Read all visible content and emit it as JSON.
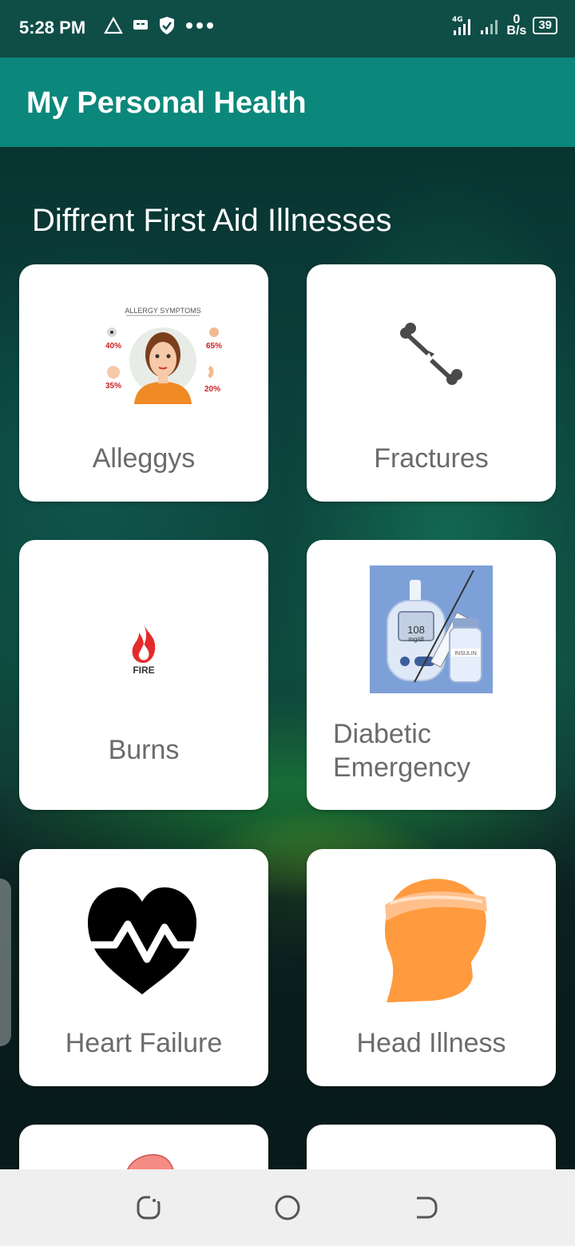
{
  "status_bar": {
    "time": "5:28 PM",
    "left_icons": [
      "alert-triangle-icon",
      "message-icon",
      "shield-check-icon",
      "more-dots-icon"
    ],
    "network": "4G",
    "data_rate_value": "0",
    "data_rate_unit": "B/s",
    "battery": "39"
  },
  "app_bar": {
    "title": "My Personal Health"
  },
  "section_title": "Diffrent First Aid Illnesses",
  "cards": [
    {
      "id": "allergies",
      "label": "Alleggys",
      "image": "allergy-symptoms-icon",
      "image_text": "ALLERGY SYMPTOMS",
      "stats": [
        "40%",
        "65%",
        "35%",
        "20%"
      ]
    },
    {
      "id": "fractures",
      "label": "Fractures",
      "image": "broken-bone-icon"
    },
    {
      "id": "burns",
      "label": "Burns",
      "image": "fire-icon",
      "image_text": "FIRE"
    },
    {
      "id": "diabetic",
      "label_line1": "Diabetic",
      "label_line2": "Emergency",
      "image": "glucose-meter-insulin-icon",
      "meter_value": "108",
      "meter_unit": "mg/dl",
      "vial_text": "INSULIN"
    },
    {
      "id": "heart",
      "label": "Heart Failure",
      "image": "heart-pulse-icon"
    },
    {
      "id": "head",
      "label": "Head Illness",
      "image": "bandaged-head-icon"
    }
  ],
  "nav_bar": {
    "buttons": [
      "recents-icon",
      "home-icon",
      "back-icon"
    ]
  },
  "colors": {
    "app_bar": "#0c877b",
    "status_bar": "#0f4e47",
    "card_text": "#6b6b6b"
  }
}
